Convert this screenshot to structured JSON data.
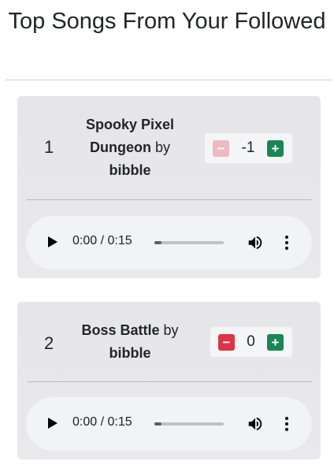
{
  "page": {
    "title": "Top Songs From Your Followed"
  },
  "songs": [
    {
      "rank": "1",
      "title_line1": "Spooky Pixel",
      "title_line2": "Dungeon",
      "by": "by",
      "artist": "bibble",
      "score": "-1",
      "minus_label": "−",
      "plus_label": "+",
      "minus_disabled": true,
      "player": {
        "time": "0:00 / 0:15",
        "progress": 0.1
      }
    },
    {
      "rank": "2",
      "title_line1": "Boss Battle",
      "by": "by",
      "artist": "bibble",
      "score": "0",
      "minus_label": "−",
      "plus_label": "+",
      "minus_disabled": false,
      "player": {
        "time": "0:00 / 0:15",
        "progress": 0.1
      }
    }
  ],
  "colors": {
    "downvote": "#dc3545",
    "downvote_disabled": "#f0b8bf",
    "upvote": "#198754"
  },
  "icons": {
    "play": "play-icon",
    "volume": "volume-icon",
    "more": "more-vert-icon"
  }
}
